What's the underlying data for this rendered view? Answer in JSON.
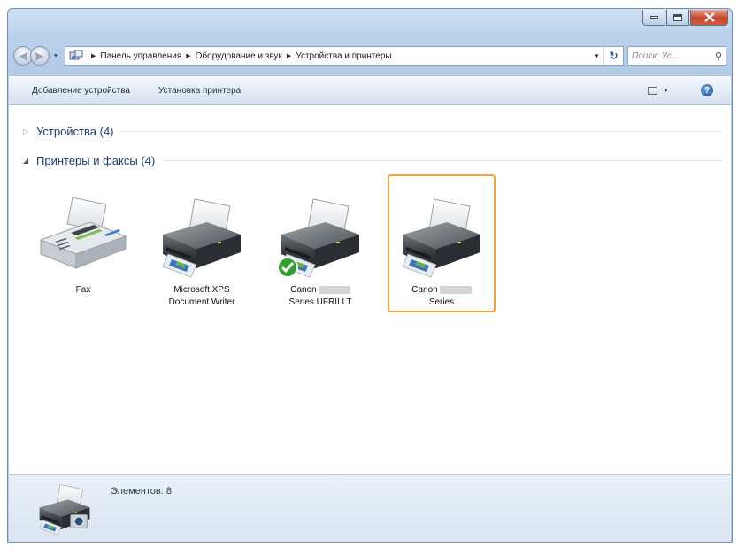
{
  "window": {
    "buttons": {
      "minimize": "minimize",
      "maximize": "maximize",
      "close": "close"
    }
  },
  "address": {
    "crumbs": [
      "Панель управления",
      "Оборудование и звук",
      "Устройства и принтеры"
    ],
    "search_placeholder": "Поиск: Ус..."
  },
  "toolbar": {
    "add_device": "Добавление устройства",
    "add_printer": "Установка принтера"
  },
  "groups": {
    "devices": "Устройства (4)",
    "printers": "Принтеры и факсы (4)"
  },
  "printers": [
    {
      "line1": "Fax",
      "line2": "",
      "icon": "fax-icon"
    },
    {
      "line1": "Microsoft XPS",
      "line2": "Document Writer",
      "icon": "printer-icon"
    },
    {
      "line1": "Canon",
      "line2": "Series UFRII LT",
      "icon": "printer-icon",
      "default": true
    },
    {
      "line1": "Canon",
      "line2": "Series",
      "icon": "printer-icon",
      "selected": true
    }
  ],
  "status": {
    "count_text": "Элементов: 8"
  },
  "colors": {
    "selection_border": "#f2a33a",
    "group_header": "#1e3d6e",
    "default_check": "#2fa02f"
  }
}
